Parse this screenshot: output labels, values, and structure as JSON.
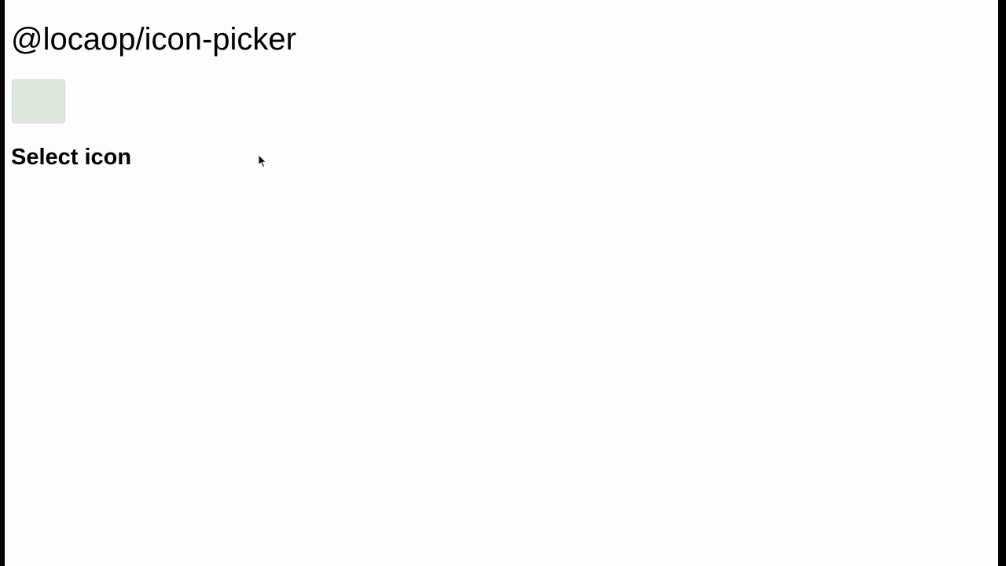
{
  "page": {
    "title": "@locaop/icon-picker",
    "background_color": "#fdfdfd",
    "frame_color": "#000000"
  },
  "icon_picker": {
    "button_color": "#dfe8df",
    "button_border_color": "#cfd8cf",
    "section_title": "Select icon"
  },
  "cursor": {
    "icon": "arrow-cursor-icon"
  }
}
